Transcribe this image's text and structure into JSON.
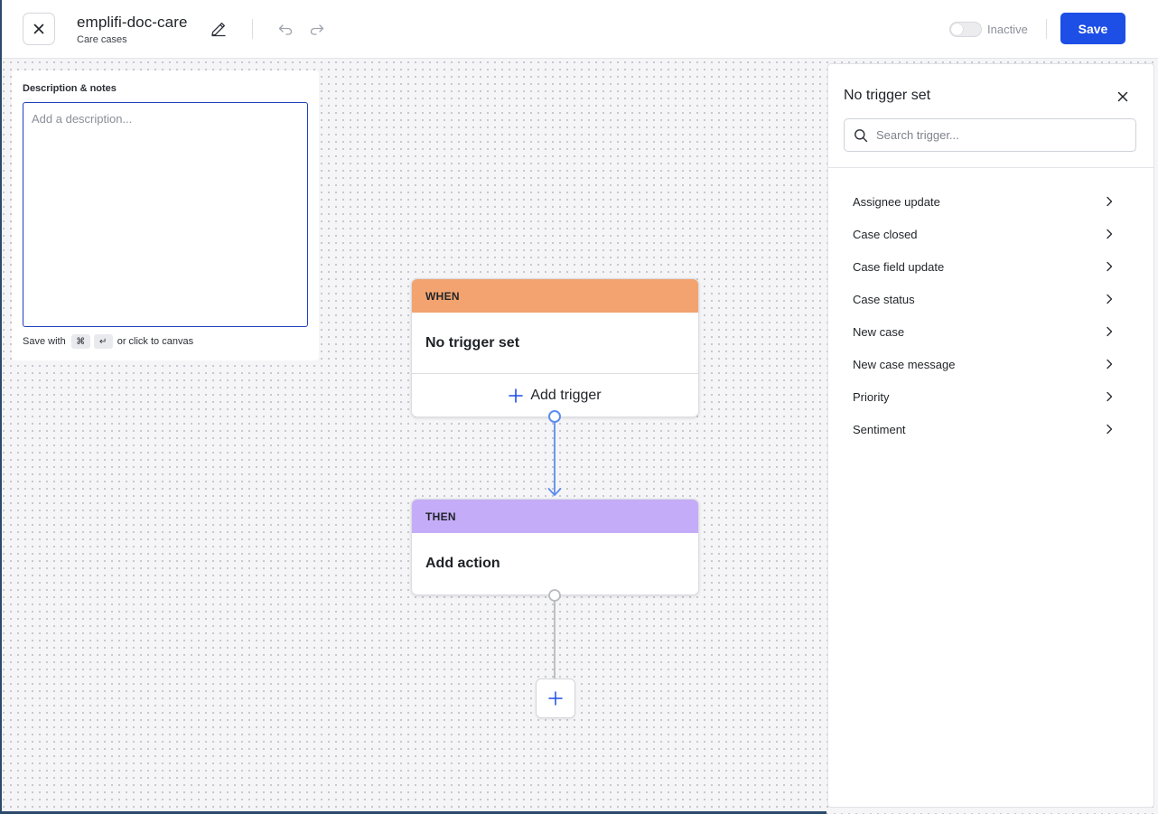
{
  "header": {
    "title": "emplifi-doc-care",
    "subtitle": "Care cases",
    "status_label": "Inactive",
    "save_label": "Save"
  },
  "notes": {
    "title": "Description & notes",
    "placeholder": "Add a description...",
    "hint_prefix": "Save with",
    "key_cmd": "⌘",
    "key_enter": "↵",
    "hint_suffix": "or click to canvas"
  },
  "flow": {
    "when": {
      "header": "WHEN",
      "body": "No trigger set",
      "add_label": "Add trigger"
    },
    "then": {
      "header": "THEN",
      "body": "Add action"
    }
  },
  "panel": {
    "title": "No trigger set",
    "search_placeholder": "Search trigger...",
    "triggers": [
      "Assignee update",
      "Case closed",
      "Case field update",
      "Case status",
      "New case",
      "New case message",
      "Priority",
      "Sentiment"
    ]
  },
  "colors": {
    "accent": "#1d4ee6",
    "when_header": "#f2a36f",
    "then_header": "#c5acf8",
    "connector_active": "#5b8def",
    "connector_idle": "#b8bac0"
  },
  "icons": {
    "close": "close-icon",
    "edit": "pencil-icon",
    "undo": "undo-icon",
    "redo": "redo-icon",
    "search": "search-icon",
    "chevron": "chevron-right-icon",
    "plus": "plus-icon"
  }
}
